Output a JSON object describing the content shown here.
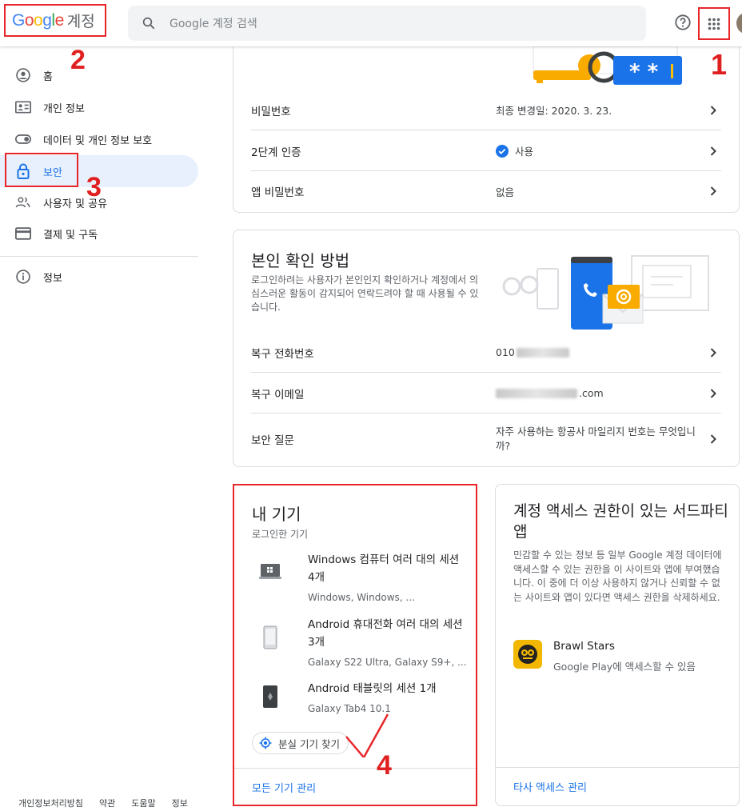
{
  "header": {
    "logo_text": "Google",
    "logo_label": "계정",
    "search_placeholder": "Google 계정 검색"
  },
  "annotations": [
    "1",
    "2",
    "3",
    "4"
  ],
  "sidebar": {
    "items": [
      {
        "label": "홈",
        "icon": "account-circle-icon"
      },
      {
        "label": "개인 정보",
        "icon": "id-card-icon"
      },
      {
        "label": "데이터 및 개인 정보 보호",
        "icon": "toggle-icon"
      },
      {
        "label": "보안",
        "icon": "lock-icon",
        "active": true
      },
      {
        "label": "사용자 및 공유",
        "icon": "people-icon"
      },
      {
        "label": "결제 및 구독",
        "icon": "credit-card-icon"
      },
      {
        "label": "정보",
        "icon": "info-icon"
      }
    ],
    "footer": [
      "개인정보처리방침",
      "약관",
      "도움말",
      "정보"
    ]
  },
  "signin": {
    "rows": [
      {
        "label": "비밀번호",
        "value": "최종 변경일: 2020. 3. 23."
      },
      {
        "label": "2단계 인증",
        "value": "사용"
      },
      {
        "label": "앱 비밀번호",
        "value": "없음"
      }
    ],
    "illustration_text": "* *"
  },
  "verify": {
    "title": "본인 확인 방법",
    "description": "로그인하려는 사용자가 본인인지 확인하거나 계정에서 의심스러운 활동이 감지되어 연락드려야 할 때 사용될 수 있습니다.",
    "rows": [
      {
        "label": "복구 전화번호",
        "value": "010"
      },
      {
        "label": "복구 이메일",
        "value": ".com"
      },
      {
        "label": "보안 질문",
        "value": "자주 사용하는 항공사 마일리지 번호는 무엇입니까?"
      }
    ]
  },
  "devices": {
    "title": "내 기기",
    "subtitle": "로그인한 기기",
    "list": [
      {
        "name": "Windows 컴퓨터 여러 대의 세션 4개",
        "sub": "Windows, Windows, ...",
        "icon": "laptop-icon"
      },
      {
        "name": "Android 휴대전화 여러 대의 세션 3개",
        "sub": "Galaxy S22 Ultra, Galaxy S9+, ...",
        "icon": "phone-icon"
      },
      {
        "name": "Android 태블릿의 세션 1개",
        "sub": "Galaxy Tab4 10.1",
        "icon": "tablet-icon"
      }
    ],
    "find_chip": "분실 기기 찾기",
    "manage_link": "모든 기기 관리"
  },
  "thirdparty": {
    "title": "계정 액세스 권한이 있는 서드파티 앱",
    "description": "민감할 수 있는 정보 등 일부 Google 계정 데이터에 액세스할 수 있는 권한을 이 사이트와 앱에 부여했습니다. 이 중에 더 이상 사용하지 않거나 신뢰할 수 없는 사이트와 앱이 있다면 액세스 권한을 삭제하세요.",
    "app_name": "Brawl Stars",
    "app_sub": "Google Play에 액세스할 수 있음",
    "manage_link": "타사 액세스 관리"
  },
  "colors": {
    "accent": "#1a73e8",
    "annotation": "#e8262a",
    "active_bg": "#e8f0fe"
  }
}
